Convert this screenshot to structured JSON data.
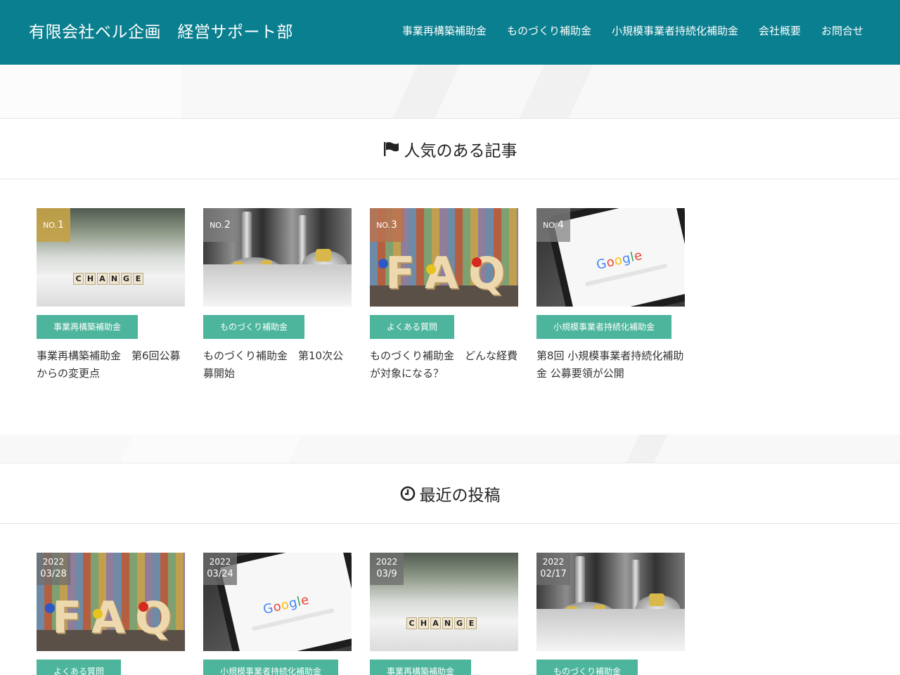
{
  "header": {
    "site_title": "有限会社ベル企画　経営サポート部",
    "nav": [
      "事業再構築補助金",
      "ものづくり補助金",
      "小規模事業者持続化補助金",
      "会社概要",
      "お問合せ"
    ],
    "bg_color": "#0a7f8f"
  },
  "popular": {
    "heading": "人気のある記事",
    "heading_icon": "flag-icon",
    "items": [
      {
        "rank_prefix": "NO.",
        "rank": "1",
        "category": "事業再構築補助金",
        "title": "事業再構築補助金　第6回公募からの変更点",
        "image": "change-blocks"
      },
      {
        "rank_prefix": "NO.",
        "rank": "2",
        "category": "ものづくり補助金",
        "title": "ものづくり補助金　第10次公募開始",
        "image": "milling-tools"
      },
      {
        "rank_prefix": "NO.",
        "rank": "3",
        "category": "よくある質問",
        "title": "ものづくり補助金　どんな経費が対象になる？",
        "image": "faq-letters"
      },
      {
        "rank_prefix": "NO.",
        "rank": "4",
        "category": "小規模事業者持続化補助金",
        "title": "第8回 小規模事業者持続化補助金 公募要領が公開",
        "image": "google-phone"
      }
    ]
  },
  "recent": {
    "heading": "最近の投稿",
    "heading_icon": "clock-icon",
    "items": [
      {
        "year": "2022",
        "date": "03/28",
        "category": "よくある質問",
        "image": "faq-letters"
      },
      {
        "year": "2022",
        "date": "03/24",
        "category": "小規模事業者持続化補助金",
        "image": "google-phone"
      },
      {
        "year": "2022",
        "date": "03/9",
        "category": "事業再構築補助金",
        "image": "change-blocks"
      },
      {
        "year": "2022",
        "date": "02/17",
        "category": "ものづくり補助金",
        "image": "milling-tools"
      }
    ]
  },
  "image_text": {
    "change_word": "CHANGE",
    "faq_word": "FAQ",
    "google_word": "Google"
  },
  "colors": {
    "category_bg": "#4cb59c",
    "rank1": "#c4a248",
    "rank3": "#ba7250"
  }
}
